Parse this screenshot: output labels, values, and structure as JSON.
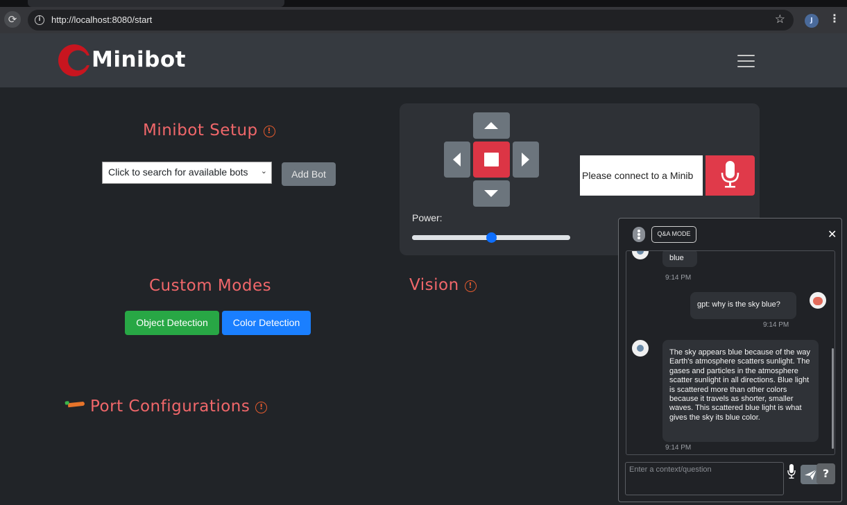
{
  "browser": {
    "url": "http://localhost:8080/start",
    "profile_initial": "J"
  },
  "navbar": {
    "brand": "Minibot"
  },
  "setup": {
    "title": "Minibot Setup",
    "select_placeholder": "Click to search for available bots",
    "add_button": "Add Bot"
  },
  "custom_modes": {
    "title": "Custom Modes",
    "object_detection": "Object Detection",
    "color_detection": "Color Detection"
  },
  "port_config": {
    "title": "Port Configurations"
  },
  "vision": {
    "title": "Vision"
  },
  "control": {
    "power_label": "Power:",
    "power_value": 0.5,
    "command_text": "Please connect to a Minib"
  },
  "chat": {
    "mode_badge": "Q&A MODE",
    "input_placeholder": "Enter a context/question",
    "messages": [
      {
        "role": "bot",
        "text": "blue",
        "time": "9:14 PM"
      },
      {
        "role": "user",
        "text": "gpt: why is the sky blue?",
        "time": "9:14 PM"
      },
      {
        "role": "bot",
        "text": "The sky appears blue because of the way Earth's atmosphere scatters sunlight. The gases and particles in the atmosphere scatter sunlight in all directions. Blue light is scattered more than other colors because it travels as shorter, smaller waves. This scattered blue light is what gives the sky its blue color.",
        "time": "9:14 PM"
      }
    ]
  },
  "colors": {
    "accent": "#f0676a",
    "danger": "#dc3545",
    "success": "#28a745",
    "primary": "#1a7fff",
    "secondary": "#6c757d"
  },
  "icons": [
    "reload-icon",
    "site-info-icon",
    "bookmark-star-icon",
    "kebab-menu-icon",
    "hamburger-menu-icon",
    "info-icon",
    "carrot-icon",
    "arrow-up-icon",
    "arrow-down-icon",
    "arrow-left-icon",
    "arrow-right-icon",
    "stop-icon",
    "microphone-icon",
    "close-icon",
    "send-icon",
    "help-icon"
  ]
}
